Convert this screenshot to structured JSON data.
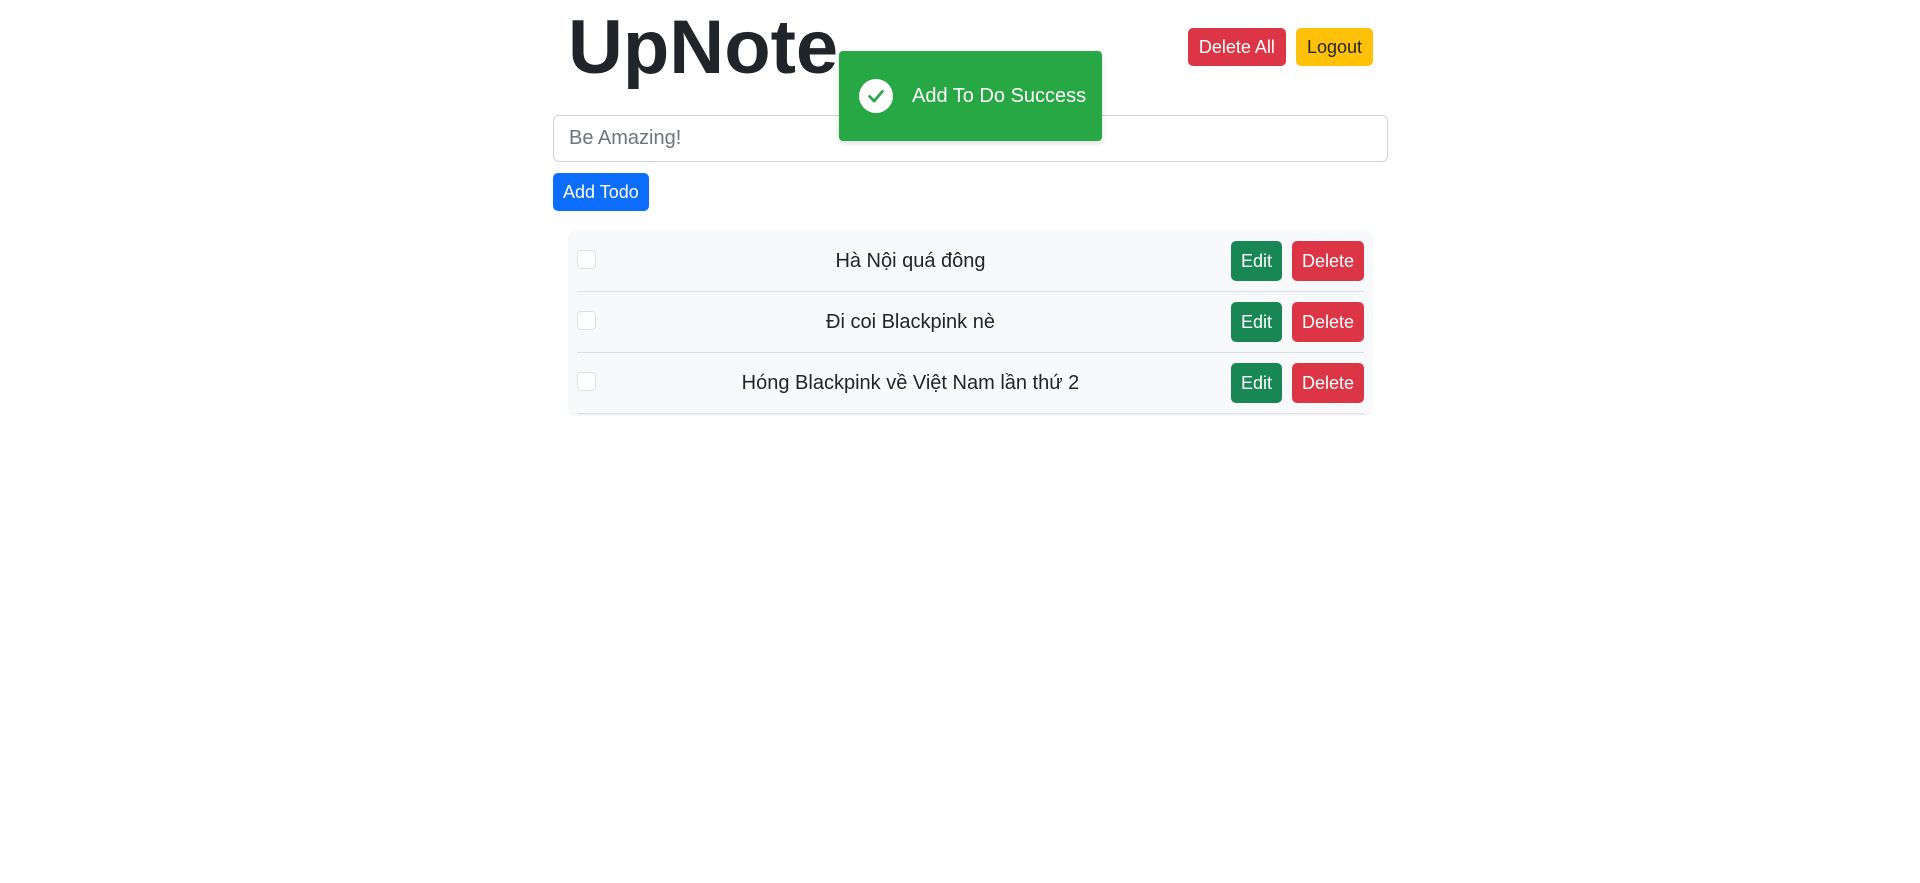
{
  "header": {
    "title": "UpNote",
    "delete_all_label": "Delete All",
    "logout_label": "Logout"
  },
  "toast": {
    "message": "Add To Do Success",
    "icon": "check-circle-icon",
    "color": "#28a745"
  },
  "form": {
    "input_value": "",
    "placeholder": "Be Amazing!",
    "add_label": "Add Todo"
  },
  "todos": [
    {
      "text": "Hà Nội quá đông",
      "checked": false,
      "edit_label": "Edit",
      "delete_label": "Delete"
    },
    {
      "text": "Đi coi Blackpink nè",
      "checked": false,
      "edit_label": "Edit",
      "delete_label": "Delete"
    },
    {
      "text": "Hóng Blackpink về Việt Nam lần thứ 2",
      "checked": false,
      "edit_label": "Edit",
      "delete_label": "Delete"
    }
  ],
  "colors": {
    "danger": "#dc3545",
    "warning": "#ffc107",
    "success": "#198754",
    "primary": "#0d6efd"
  }
}
